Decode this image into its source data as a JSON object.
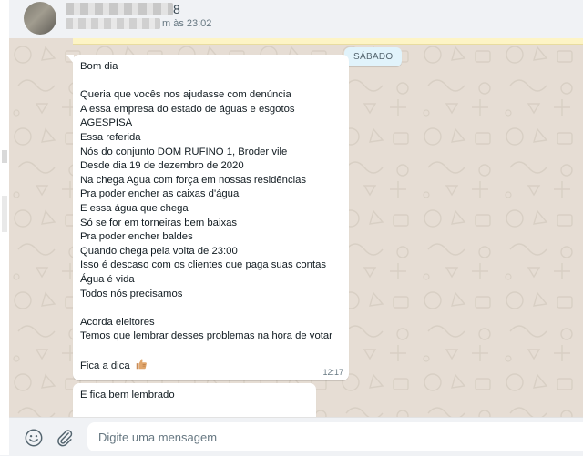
{
  "contact": {
    "name_tail": "8",
    "last_seen_tail": "m às 23:02"
  },
  "chat": {
    "day_label": "SÁBADO",
    "messages": [
      {
        "text": "Bom dia\n\nQueria que vocês nos ajudasse com denúncia\nA essa empresa do estado de águas e esgotos\nAGESPISA\nEssa referida\nNós do conjunto DOM RUFINO 1, Broder vile\nDesde dia 19 de dezembro de 2020\nNa chega Agua com força em nossas residências\nPra poder encher as caixas d'água\nE essa água que chega\nSó se for em torneiras bem baixas\nPra poder encher baldes\nQuando chega pela volta de 23:00\nIsso é descaso com os clientes que paga suas contas\nÁgua é vida\nTodos nós precisamos\n\nAcorda eleitores\nTemos que lembrar desses problemas na hora de votar\n\nFica a dica ",
        "emoji": "thumbs-up-icon",
        "time": "12:17"
      },
      {
        "text": "E fica bem lembrado"
      }
    ]
  },
  "composer": {
    "placeholder": "Digite uma mensagem",
    "value": ""
  },
  "icons": {
    "emoji": "emoji-icon",
    "attach": "paperclip-icon"
  },
  "colors": {
    "chat_background": "#e6ddd4",
    "bubble_incoming": "#ffffff",
    "day_chip": "#e1f3fb",
    "notice": "#fdf4c5"
  }
}
